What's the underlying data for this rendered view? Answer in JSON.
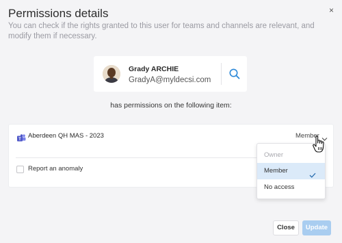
{
  "dialog": {
    "title": "Permissions details",
    "subtitle": "You can check if the rights granted to this user for teams and channels are relevant, and modify them if necessary.",
    "close_glyph": "×"
  },
  "user": {
    "name": "Grady ARCHIE",
    "email": "GradyA@myldecsi.com",
    "search_icon": "search-icon"
  },
  "permissions_text": "has permissions on the following item:",
  "item": {
    "icon": "teams-icon",
    "name": "Aberdeen QH MAS - 2023",
    "role": "Member"
  },
  "anomaly": {
    "label": "Report an anomaly",
    "checked": false
  },
  "role_dropdown": {
    "options": [
      {
        "label": "Owner",
        "disabled": true,
        "selected": false
      },
      {
        "label": "Member",
        "disabled": false,
        "selected": true
      },
      {
        "label": "No access",
        "disabled": false,
        "selected": false
      }
    ]
  },
  "footer": {
    "close_label": "Close",
    "update_label": "Update"
  },
  "colors": {
    "accent": "#2b88d8",
    "selected_bg": "#dbeaf9",
    "update_disabled": "#a9cdf0",
    "teams": "#5059c9"
  }
}
